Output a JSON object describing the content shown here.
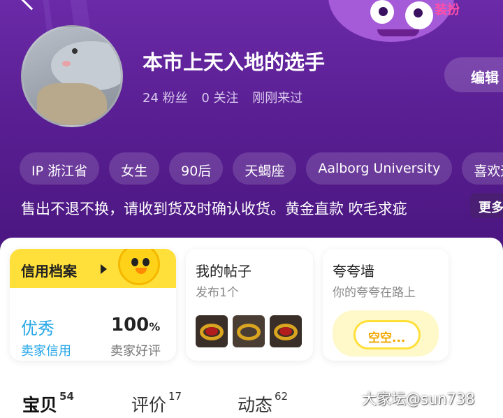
{
  "header": {
    "dress_label": "装扮",
    "username": "本市上天入地的选手",
    "stats": {
      "fans": "24 粉丝",
      "following": "0 关注",
      "last_seen": "刚刚来过"
    },
    "edit_label": "编辑",
    "tags": [
      "IP 浙江省",
      "女生",
      "90后",
      "天蝎座",
      "Aalborg University",
      "喜欢运"
    ],
    "bio": "售出不退不换，请收到货及时确认收货。黄金直款 吹毛求疵",
    "more_label": "更多"
  },
  "credit_card": {
    "title": "信用档案",
    "grade": "优秀",
    "grade_label": "卖家信用",
    "rating": "100",
    "rating_unit": "%",
    "rating_label": "卖家好评"
  },
  "posts_card": {
    "title": "我的帖子",
    "subtitle": "发布1个"
  },
  "praise_card": {
    "title": "夸夸墙",
    "subtitle": "你的夸夸在路上",
    "empty_label": "空空..."
  },
  "tabs": [
    {
      "label": "宝贝",
      "count": "54"
    },
    {
      "label": "评价",
      "count": "17"
    },
    {
      "label": "动态",
      "count": "62"
    }
  ],
  "watermark": "大家坛@sun738",
  "colors": {
    "header_bg": "#5a1f93",
    "accent_yellow": "#ffe03a",
    "credit_blue": "#27a7e8",
    "dress_pink": "#ff4fa8"
  }
}
